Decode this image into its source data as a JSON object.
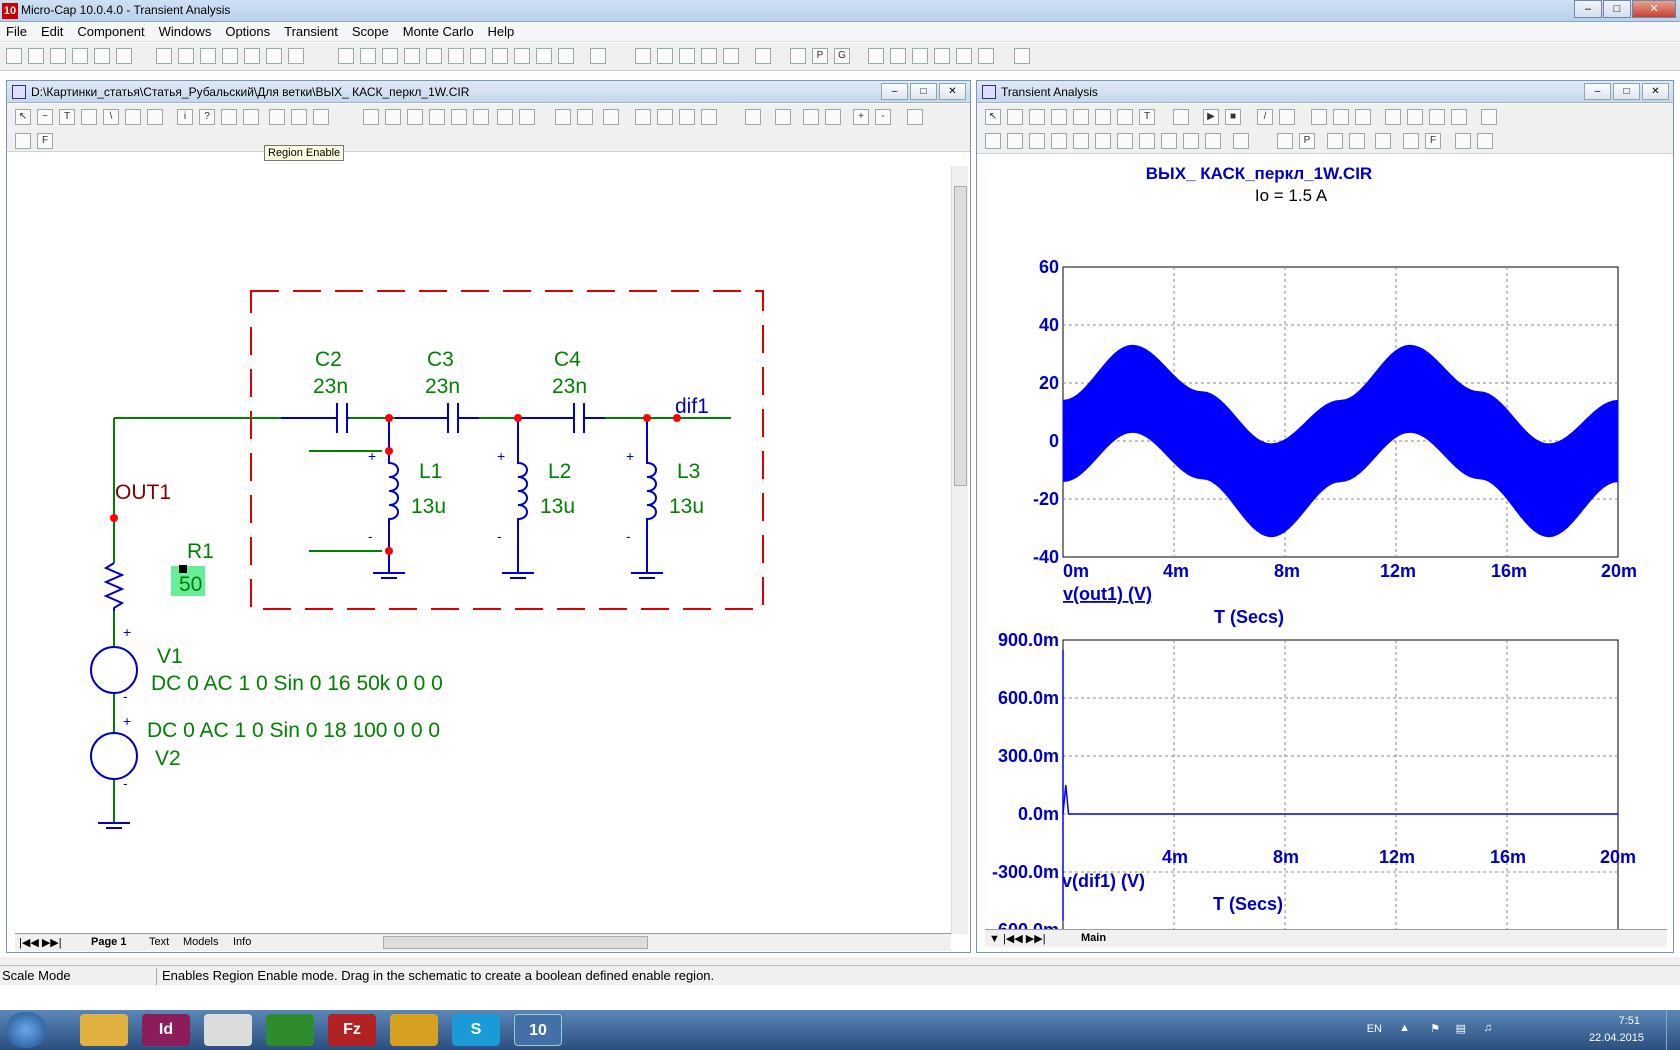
{
  "app": {
    "title": "Micro-Cap 10.0.4.0 - Transient Analysis",
    "icon_label": "10"
  },
  "menu": [
    "File",
    "Edit",
    "Component",
    "Windows",
    "Options",
    "Transient",
    "Scope",
    "Monte Carlo",
    "Help"
  ],
  "schematic": {
    "window_title": "D:\\Картинки_статья\\Статья_Рубальский\\Для ветки\\ВЫХ_ КАСК_перкл_1W.CIR",
    "tooltip": "Region Enable",
    "tabs": [
      "Page 1",
      "Text",
      "Models",
      "Info"
    ],
    "components": {
      "C2": {
        "name": "C2",
        "value": "23n"
      },
      "C3": {
        "name": "C3",
        "value": "23n"
      },
      "C4": {
        "name": "C4",
        "value": "23n"
      },
      "L1": {
        "name": "L1",
        "value": "13u"
      },
      "L2": {
        "name": "L2",
        "value": "13u"
      },
      "L3": {
        "name": "L3",
        "value": "13u"
      },
      "R1": {
        "name": "R1",
        "value": "50"
      },
      "V1": {
        "name": "V1",
        "value": "DC 0 AC 1 0 Sin 0 16 50k 0 0 0"
      },
      "V2": {
        "name": "V2",
        "value": "DC 0 AC 1 0 Sin 0 18 100 0 0 0"
      }
    },
    "nodes": {
      "out1": "OUT1",
      "dif1": "dif1"
    },
    "colors": {
      "wire": "#008000",
      "component": "#0000c0",
      "node": "#ff0000",
      "region": "#dd0000",
      "label": "#008000",
      "node_label_out": "#800000",
      "highlight": "#66ee99"
    }
  },
  "transient": {
    "window_title": "Transient Analysis",
    "plot_title": "ВЫХ_ КАСК_перкл_1W.CIR",
    "annotation": "Io = 1.5 A",
    "tab": "Main",
    "plot1": {
      "ylabel": "v(out1) (V)",
      "xlabel": "T (Secs)",
      "yticks": [
        "60",
        "40",
        "20",
        "0",
        "-20",
        "-40"
      ],
      "xticks": [
        "0m",
        "4m",
        "8m",
        "12m",
        "16m",
        "20m"
      ]
    },
    "plot2": {
      "ylabel": "v(dif1) (V)",
      "xlabel": "T (Secs)",
      "yticks": [
        "900.0m",
        "600.0m",
        "300.0m",
        "0.0m",
        "-300.0m",
        "-600.0m"
      ],
      "xticks": [
        "0m",
        "4m",
        "8m",
        "12m",
        "16m",
        "20m"
      ]
    }
  },
  "chart_data": [
    {
      "type": "area",
      "title": "ВЫХ_ КАСК_перкл_1W.CIR",
      "xlabel": "T (Secs)",
      "ylabel": "v(out1) (V)",
      "xlim": [
        0,
        20
      ],
      "ylim": [
        -40,
        60
      ],
      "series": [
        {
          "name": "v(out1) (V)",
          "x": [
            0,
            2.5,
            5,
            7.5,
            10,
            12.5,
            15,
            17.5,
            20
          ],
          "upper": [
            14,
            33,
            17,
            -1,
            14,
            33,
            17,
            -1,
            14
          ],
          "lower": [
            -14,
            3,
            -13,
            -33,
            -14,
            3,
            -13,
            -33,
            -14
          ]
        }
      ],
      "annotation": "Io = 1.5 A"
    },
    {
      "type": "line",
      "xlabel": "T (Secs)",
      "ylabel": "v(dif1) (V)",
      "xlim": [
        0,
        20
      ],
      "ylim": [
        -600,
        900
      ],
      "series": [
        {
          "name": "v(dif1) (V)",
          "x": [
            0,
            0.1,
            0.2,
            0.5,
            20
          ],
          "values": [
            0,
            150,
            0,
            0,
            0
          ]
        }
      ]
    }
  ],
  "status": {
    "mode": "Scale Mode",
    "message": "Enables Region Enable mode.  Drag in the schematic to create a boolean defined enable region."
  },
  "tray": {
    "lang": "EN",
    "time": "7:51",
    "date": "22.04.2015"
  }
}
